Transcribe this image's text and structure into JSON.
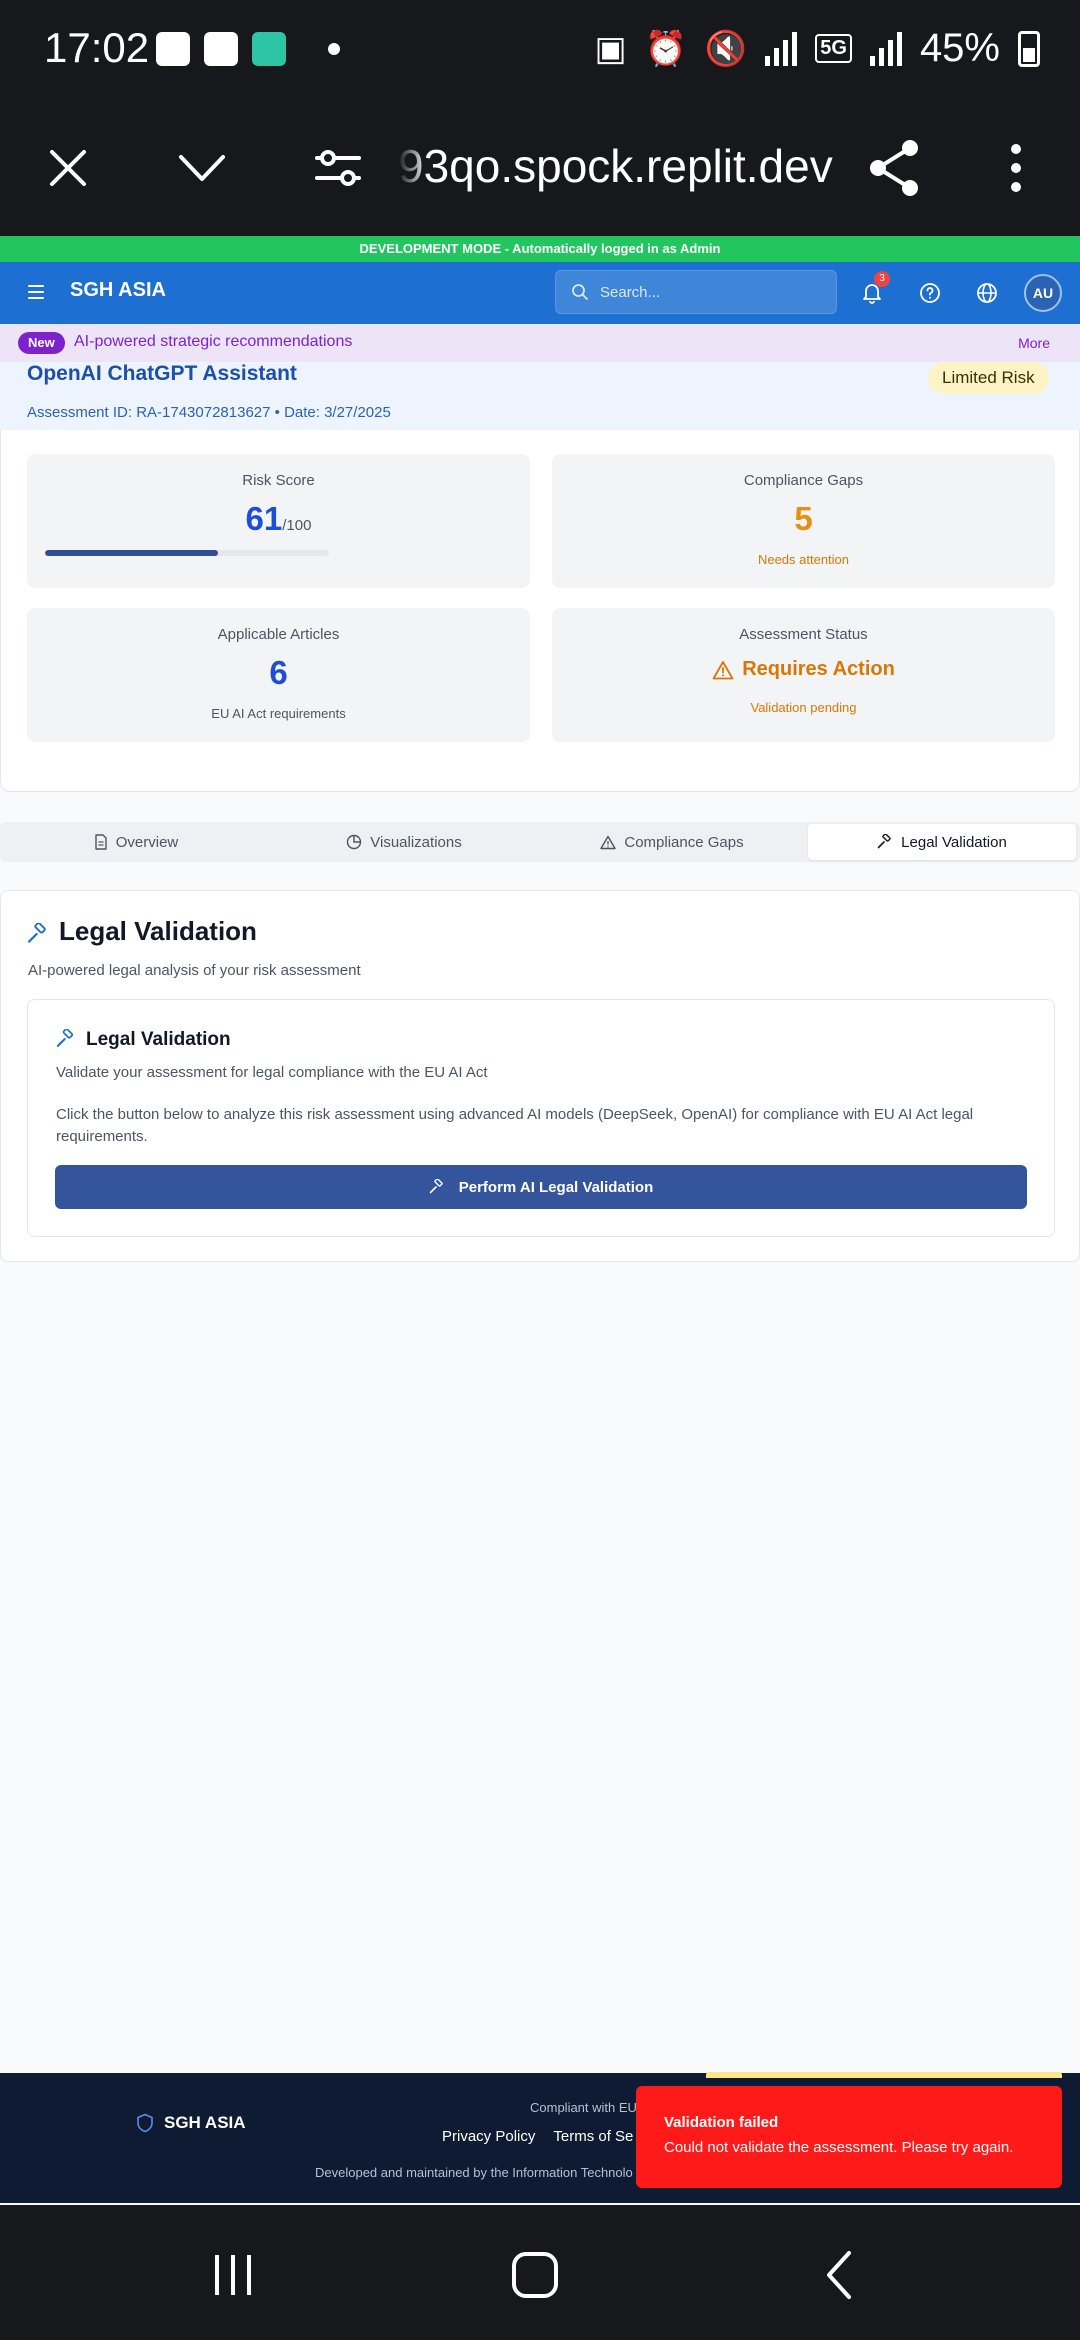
{
  "status_bar": {
    "time": "17:02",
    "network": "5G",
    "battery": "45%"
  },
  "browser": {
    "url": "93qo.spock.replit.dev",
    "icons": [
      "close-icon",
      "chevron-down-icon",
      "tune-icon",
      "share-icon",
      "more-vert-icon"
    ]
  },
  "dev_banner": "DEVELOPMENT MODE - Automatically logged in as Admin",
  "header": {
    "brand": "SGH ASIA",
    "search_placeholder": "Search...",
    "notification_count": "3",
    "avatar_initials": "AU",
    "accent_color": "#1d70d1"
  },
  "announcement": {
    "badge": "New",
    "text": "AI-powered strategic recommendations",
    "more": "More"
  },
  "assessment": {
    "title": "OpenAI ChatGPT Assistant",
    "meta": "Assessment ID: RA-1743072813627 • Date: 3/27/2025",
    "risk_level": "Limited Risk"
  },
  "stats": {
    "risk_score": {
      "label": "Risk Score",
      "value": "61",
      "unit": "/100",
      "progress_percent": 61
    },
    "compliance_gaps": {
      "label": "Compliance Gaps",
      "value": "5",
      "sub": "Needs attention"
    },
    "applicable_articles": {
      "label": "Applicable Articles",
      "value": "6",
      "sub": "EU AI Act requirements"
    },
    "assessment_status": {
      "label": "Assessment Status",
      "value": "Requires Action",
      "sub": "Validation pending"
    }
  },
  "tabs": [
    {
      "label": "Overview",
      "icon": "document-icon"
    },
    {
      "label": "Visualizations",
      "icon": "pie-chart-icon"
    },
    {
      "label": "Compliance Gaps",
      "icon": "warning-icon"
    },
    {
      "label": "Legal Validation",
      "icon": "gavel-icon",
      "active": true
    }
  ],
  "legal_validation": {
    "title": "Legal Validation",
    "description": "AI-powered legal analysis of your risk assessment",
    "card_title": "Legal Validation",
    "card_description": "Validate your assessment for legal compliance with the EU AI Act",
    "card_paragraph": "Click the button below to analyze this risk assessment using advanced AI models (DeepSeek, OpenAI) for compliance with EU AI Act legal requirements.",
    "button_label": "Perform AI Legal Validation"
  },
  "footer": {
    "brand": "SGH ASIA",
    "compliant_text": "Compliant with EU",
    "links": [
      "Privacy Policy",
      "Terms of Se"
    ],
    "developed_text": "Developed and maintained by the Information Technolo"
  },
  "toast": {
    "title": "Validation failed",
    "message": "Could not validate the assessment. Please try again.",
    "color": "#ff1a1a"
  }
}
